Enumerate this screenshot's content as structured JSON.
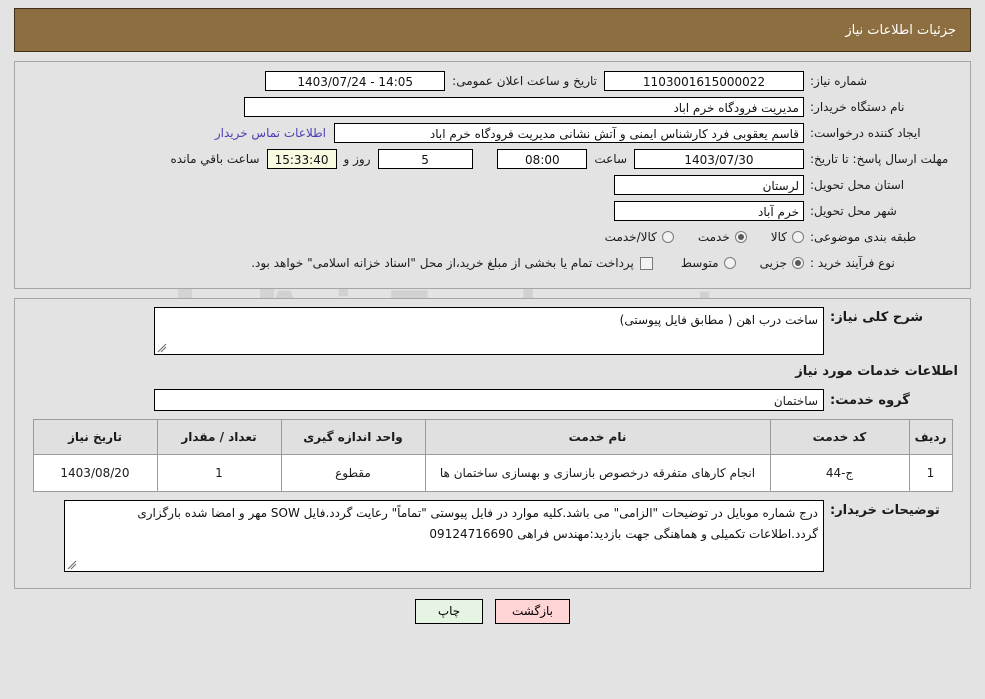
{
  "header": {
    "title": "جزئیات اطلاعات نیاز",
    "bar_color": "#8d6e41"
  },
  "watermark": {
    "text": "AriaTender.net"
  },
  "info": {
    "need_no_label": "شماره نیاز:",
    "need_no_value": "1103001615000022",
    "public_announce_label": "تاریخ و ساعت اعلان عمومی:",
    "public_announce_value": "1403/07/24 - 14:05",
    "buyer_org_label": "نام دستگاه خریدار:",
    "buyer_org_value": "مدیریت فرودگاه خرم اباد",
    "creator_label": "ایجاد کننده درخواست:",
    "creator_value": "قاسم یعقوبی فرد کارشناس ایمنی و آتش نشانی مدیریت فرودگاه خرم اباد",
    "contact_link": "اطلاعات تماس خریدار",
    "deadline_label": "مهلت ارسال پاسخ: تا تاریخ:",
    "deadline_date": "1403/07/30",
    "hour_label": "ساعت",
    "deadline_hour": "08:00",
    "days_value": "5",
    "days_label": "روز و",
    "countdown_value": "15:33:40",
    "countdown_label": "ساعت باقي مانده",
    "province_label": "استان محل تحویل:",
    "province_value": "لرستان",
    "city_label": "شهر محل تحویل:",
    "city_value": "خرم آباد",
    "category_label": "طبقه بندی موضوعی:",
    "category_options": [
      {
        "label": "کالا",
        "checked": false
      },
      {
        "label": "خدمت",
        "checked": true
      },
      {
        "label": "کالا/خدمت",
        "checked": false
      }
    ],
    "process_label": "نوع فرآیند خرید :",
    "process_options": [
      {
        "label": "جزیی",
        "checked": true
      },
      {
        "label": "متوسط",
        "checked": false
      }
    ],
    "treasury_checkbox_label": "پرداخت تمام یا بخشی از مبلغ خرید،از محل \"اسناد خزانه اسلامی\" خواهد بود.",
    "treasury_checked": false
  },
  "description": {
    "general_label": "شرح کلی نیاز:",
    "general_value": "ساخت درب اهن ( مطابق فایل پیوستی)",
    "services_section_title": "اطلاعات خدمات مورد نیاز",
    "service_group_label": "گروه خدمت:",
    "service_group_value": "ساختمان"
  },
  "items_table": {
    "columns": [
      "ردیف",
      "کد خدمت",
      "نام خدمت",
      "واحد اندازه گیری",
      "تعداد / مقدار",
      "تاریخ نیاز"
    ],
    "rows": [
      {
        "radif": "1",
        "code": "ج-44",
        "name": "انجام کارهای متفرقه درخصوص بازسازی و بهسازی ساختمان ها",
        "unit": "مقطوع",
        "qty": "1",
        "date": "1403/08/20"
      }
    ]
  },
  "notes": {
    "label": "توضیحات خریدار:",
    "value": "درج شماره موبایل در توضیحات \"الزامی\" می باشد.کلیه موارد در فایل پیوستی  \"تماماً\" رعایت گردد.فایل SOW مهر و امضا شده بارگزاری گردد.اطلاعات تکمیلی و هماهنگی جهت بازدید:مهندس فراهی 09124716690"
  },
  "footer": {
    "back_label": "بازگشت",
    "print_label": "چاپ"
  }
}
